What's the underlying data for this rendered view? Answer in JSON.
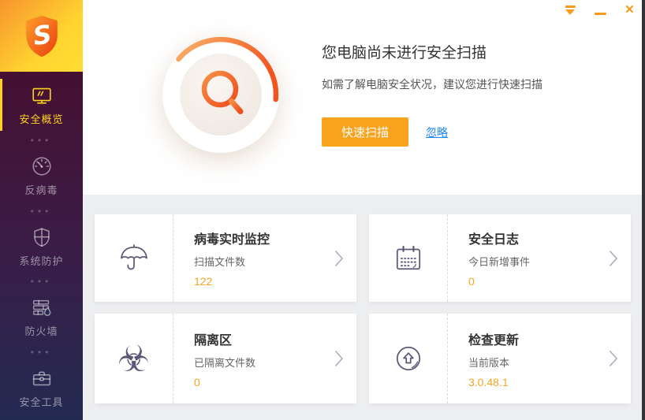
{
  "window": {
    "controls": {
      "close_glyph": "×"
    }
  },
  "sidebar": {
    "separator_glyph": "•••",
    "items": [
      {
        "label": "安全概览",
        "icon": "monitor-icon",
        "active": true
      },
      {
        "label": "反病毒",
        "icon": "gauge-icon",
        "active": false
      },
      {
        "label": "系统防护",
        "icon": "shield-icon",
        "active": false
      },
      {
        "label": "防火墙",
        "icon": "firewall-icon",
        "active": false
      },
      {
        "label": "安全工具",
        "icon": "toolbox-icon",
        "active": false
      }
    ]
  },
  "hero": {
    "title": "您电脑尚未进行安全扫描",
    "subtitle": "如需了解电脑安全状况，建议您进行快速扫描",
    "scan_button": "快速扫描",
    "ignore_link": "忽略"
  },
  "cards": [
    {
      "title": "病毒实时监控",
      "subtitle": "扫描文件数",
      "value": "122",
      "icon": "umbrella-icon"
    },
    {
      "title": "安全日志",
      "subtitle": "今日新增事件",
      "value": "0",
      "icon": "calendar-icon"
    },
    {
      "title": "隔离区",
      "subtitle": "已隔离文件数",
      "value": "0",
      "icon": "biohazard-icon",
      "glyph": "☣"
    },
    {
      "title": "检查更新",
      "subtitle": "当前版本",
      "value": "3.0.48.1",
      "icon": "update-icon"
    }
  ],
  "colors": {
    "accent_orange": "#F9A21C",
    "value_orange": "#F5A623",
    "link_blue": "#1E88F7",
    "logo_gradient_start": "#F7952E",
    "logo_gradient_end": "#FFDD35",
    "sidebar_gradient_top": "#451031",
    "sidebar_gradient_bottom": "#232A52",
    "active_item_yellow": "#FFD21E",
    "card_icon_slate": "#5B5877",
    "cards_bg": "#EDEEF0"
  }
}
